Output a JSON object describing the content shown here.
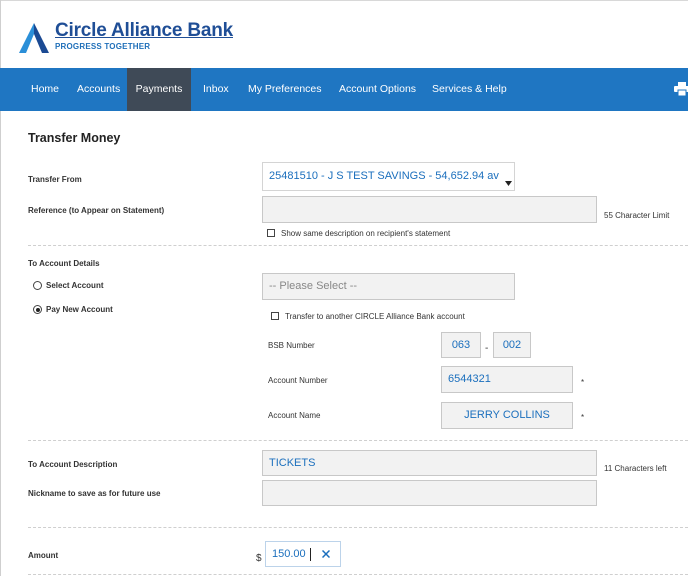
{
  "bank": {
    "name": "Circle Alliance Bank",
    "tagline": "PROGRESS TOGETHER",
    "brand_color": "#1f76c2"
  },
  "nav": {
    "items": [
      {
        "label": "Home"
      },
      {
        "label": "Accounts"
      },
      {
        "label": "Payments",
        "active": true
      },
      {
        "label": "Inbox"
      },
      {
        "label": "My Preferences"
      },
      {
        "label": "Account Options"
      },
      {
        "label": "Services & Help"
      }
    ],
    "print_icon": "printer-icon"
  },
  "page": {
    "title": "Transfer Money"
  },
  "form": {
    "transfer_from": {
      "label": "Transfer From",
      "value": "25481510 - J S TEST SAVINGS - 54,652.94 av"
    },
    "reference": {
      "label": "Reference (to Appear on Statement)",
      "value": "",
      "limit_note": "55 Character Limit",
      "show_desc_label": "Show same description on recipient's statement",
      "show_desc_checked": false
    },
    "to_account": {
      "section_label": "To Account Details",
      "select_label": "Select Account",
      "new_label": "Pay New Account",
      "selected": "new",
      "select_placeholder": "-- Please Select --",
      "transfer_circle_label": "Transfer to another CIRCLE Alliance Bank account",
      "transfer_circle_checked": false,
      "bsb_label": "BSB Number",
      "bsb_part1": "063",
      "bsb_separator": "-",
      "bsb_part2": "002",
      "account_number_label": "Account Number",
      "account_number": "6544321",
      "account_name_label": "Account Name",
      "account_name": "JERRY COLLINS",
      "required_mark": "*"
    },
    "description": {
      "label": "To Account Description",
      "value": "TICKETS",
      "chars_left": "11 Characters left"
    },
    "nickname": {
      "label": "Nickname to save as for future use",
      "value": ""
    },
    "amount": {
      "label": "Amount",
      "currency": "$",
      "value": "150.00",
      "clear_icon": "clear-x-icon"
    }
  }
}
